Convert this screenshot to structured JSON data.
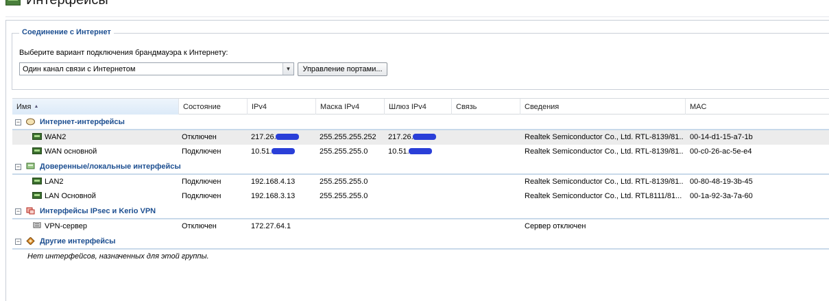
{
  "page": {
    "title": "Интерфейсы"
  },
  "connection": {
    "legend": "Соединение с Интернет",
    "prompt": "Выберите вариант подключения брандмауэра к Интернету:",
    "selected_option": "Один канал связи с Интернетом",
    "ports_button": "Управление портами..."
  },
  "table": {
    "columns": [
      "Имя",
      "Состояние",
      "IPv4",
      "Маска IPv4",
      "Шлюз IPv4",
      "Связь",
      "Сведения",
      "MAC"
    ],
    "groups": [
      {
        "name": "Интернет-интерфейсы",
        "icon": "globe-icon",
        "rows": [
          {
            "name": "WAN2",
            "state": "Отключен",
            "ipv4": "217.26.",
            "mask": "255.255.255.252",
            "gateway": "217.26.",
            "link": "",
            "info": "Realtek Semiconductor Co., Ltd. RTL-8139/81...",
            "mac": "00-14-d1-15-a7-1b",
            "icon": "network-card-icon"
          },
          {
            "name": "WAN основной",
            "state": "Подключен",
            "ipv4": "10.51.",
            "mask": "255.255.255.0",
            "gateway": "10.51.",
            "link": "",
            "info": "Realtek Semiconductor Co., Ltd. RTL-8139/81...",
            "mac": "00-c0-26-ac-5e-e4",
            "icon": "network-card-icon"
          }
        ]
      },
      {
        "name": "Доверенные/локальные интерфейсы",
        "icon": "local-network-icon",
        "rows": [
          {
            "name": "LAN2",
            "state": "Подключен",
            "ipv4": "192.168.4.13",
            "mask": "255.255.255.0",
            "gateway": "",
            "link": "",
            "info": "Realtek Semiconductor Co., Ltd. RTL-8139/81...",
            "mac": "00-80-48-19-3b-45",
            "icon": "network-card-icon"
          },
          {
            "name": "LAN Основной",
            "state": "Подключен",
            "ipv4": "192.168.3.13",
            "mask": "255.255.255.0",
            "gateway": "",
            "link": "",
            "info": "Realtek Semiconductor Co., Ltd. RTL8111/81...",
            "mac": "00-1a-92-3a-7a-60",
            "icon": "network-card-icon"
          }
        ]
      },
      {
        "name": "Интерфейсы IPsec и Kerio VPN",
        "icon": "vpn-icon",
        "rows": [
          {
            "name": "VPN-сервер",
            "state": "Отключен",
            "ipv4": "172.27.64.1",
            "mask": "",
            "gateway": "",
            "link": "",
            "info": "Сервер отключен",
            "mac": "",
            "icon": "vpn-server-icon"
          }
        ]
      },
      {
        "name": "Другие интерфейсы",
        "icon": "other-interfaces-icon",
        "empty_message": "Нет интерфейсов, назначенных для этой группы."
      }
    ]
  },
  "colors": {
    "group_label": "#1d4f91",
    "selected_row": "#ececec",
    "redaction": "#2a3fd8"
  }
}
